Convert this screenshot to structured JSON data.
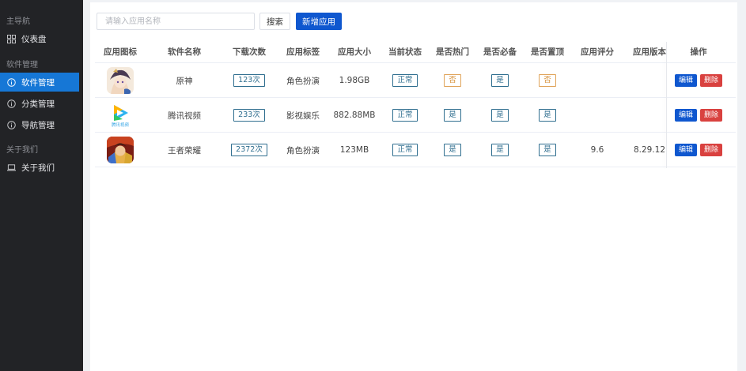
{
  "sidebar": {
    "groups": [
      {
        "title": "主导航",
        "items": [
          {
            "label": "仪表盘",
            "icon": "dashboard-grid-icon"
          }
        ]
      },
      {
        "title": "软件管理",
        "items": [
          {
            "label": "软件管理",
            "icon": "info-circle-icon",
            "active": true
          },
          {
            "label": "分类管理",
            "icon": "info-circle-icon"
          },
          {
            "label": "导航管理",
            "icon": "info-circle-icon"
          }
        ]
      },
      {
        "title": "关于我们",
        "items": [
          {
            "label": "关于我们",
            "icon": "laptop-icon"
          }
        ]
      }
    ]
  },
  "toolbar": {
    "search_placeholder": "请输入应用名称",
    "search_value": "",
    "search_label": "搜索",
    "add_label": "新增应用"
  },
  "table": {
    "columns": [
      "应用图标",
      "软件名称",
      "下载次数",
      "应用标签",
      "应用大小",
      "当前状态",
      "是否热门",
      "是否必备",
      "是否置顶",
      "应用评分",
      "应用版本",
      "操作"
    ],
    "rows": [
      {
        "icon": "genshin-app-icon",
        "name": "原神",
        "downloads": "123次",
        "tag": "角色扮演",
        "size": "1.98GB",
        "status": "正常",
        "hot": "否",
        "essential": "是",
        "top": "否",
        "rating": "",
        "version": ""
      },
      {
        "icon": "tencent-video-app-icon",
        "name": "腾讯视频",
        "downloads": "233次",
        "tag": "影视娱乐",
        "size": "882.88MB",
        "status": "正常",
        "hot": "是",
        "essential": "是",
        "top": "是",
        "rating": "",
        "version": "",
        "icon_caption": "腾讯视频"
      },
      {
        "icon": "honor-of-kings-app-icon",
        "name": "王者荣耀",
        "downloads": "2372次",
        "tag": "角色扮演",
        "size": "123MB",
        "status": "正常",
        "hot": "是",
        "essential": "是",
        "top": "是",
        "rating": "9.6",
        "version": "8.29.12"
      }
    ],
    "edit_label": "编辑",
    "delete_label": "删除"
  },
  "colors": {
    "sidebar_bg": "#222326",
    "active_item": "#1677d6",
    "primary": "#0f57cf",
    "danger": "#d9413f",
    "tag_border": "#2f6e8f",
    "warn_tag": "#d48a2d"
  }
}
